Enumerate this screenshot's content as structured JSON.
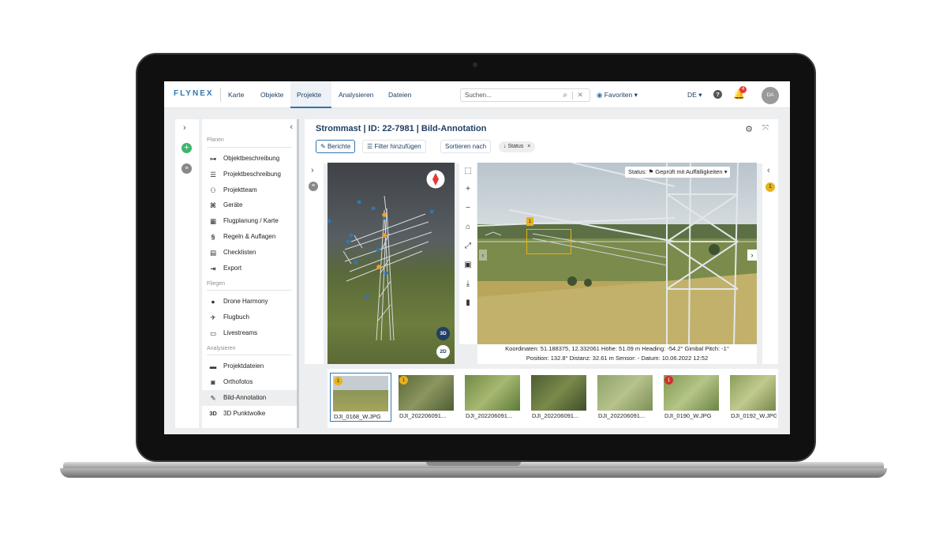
{
  "brand": {
    "logo": "FLYNEX"
  },
  "nav": [
    {
      "label": "Karte"
    },
    {
      "label": "Objekte"
    },
    {
      "label": "Projekte"
    },
    {
      "label": "Analysieren"
    },
    {
      "label": "Dateien"
    }
  ],
  "search": {
    "placeholder": "Suchen..."
  },
  "favorites": {
    "label": "Favoriten"
  },
  "language": {
    "label": "DE"
  },
  "notifications": {
    "count": "4"
  },
  "user": {
    "initials": "DA"
  },
  "sidebar": {
    "sections": [
      {
        "title": "Planen",
        "items": [
          "Objektbeschreibung",
          "Projektbeschreibung",
          "Projektteam",
          "Geräte",
          "Flugplanung / Karte",
          "Regeln & Auflagen",
          "Checklisten",
          "Export"
        ]
      },
      {
        "title": "Fliegen",
        "items": [
          "Drone Harmony",
          "Flugbuch",
          "Livestreams"
        ]
      },
      {
        "title": "Analysieren",
        "items": [
          "Projektdateien",
          "Orthofotos",
          "Bild-Annotation",
          "3D Punktwolke"
        ]
      }
    ],
    "selected": "Bild-Annotation",
    "icon_3d_label": "3D"
  },
  "page": {
    "title": "Strommast | ID: 22-7981 | Bild-Annotation",
    "buttons": {
      "reports": "Berichte",
      "filter": "Filter hinzufügen",
      "sort": "Sortieren nach"
    },
    "chip": "Status"
  },
  "viewer3d": {
    "btn_3d": "3D",
    "btn_2d": "2D"
  },
  "photo": {
    "status_label": "Status:",
    "status_value": "Geprüft mit Auffälligkeiten",
    "annotation_number": "1",
    "right_count": "1",
    "meta_line1": "Koordinaten: 51.188375, 12.332061   Höhe: 51.09 m   Heading: -54.2°   Gimbal Pitch: -1°",
    "meta_line2": "Position: 132.8°   Distanz: 32.61 m   Sensor: -   Datum: 10.06.2022 12:52"
  },
  "thumbnails": [
    {
      "name": "DJI_0168_W.JPG",
      "badge": "1",
      "badge_color": "#e8b21b"
    },
    {
      "name": "DJI_202206091...",
      "badge": "1",
      "badge_color": "#e8b21b"
    },
    {
      "name": "DJI_202206091...",
      "badge": "",
      "badge_color": ""
    },
    {
      "name": "DJI_202206091...",
      "badge": "",
      "badge_color": ""
    },
    {
      "name": "DJI_202206091...",
      "badge": "",
      "badge_color": ""
    },
    {
      "name": "DJI_0190_W.JPG",
      "badge": "1",
      "badge_color": "#d32f2f"
    },
    {
      "name": "DJI_0192_W.JPG",
      "badge": "",
      "badge_color": ""
    }
  ],
  "colors": {
    "accent": "#2f77b3",
    "navy": "#1f3f63",
    "warning": "#e8b21b",
    "danger": "#d32f2f",
    "success": "#3fb56f"
  }
}
